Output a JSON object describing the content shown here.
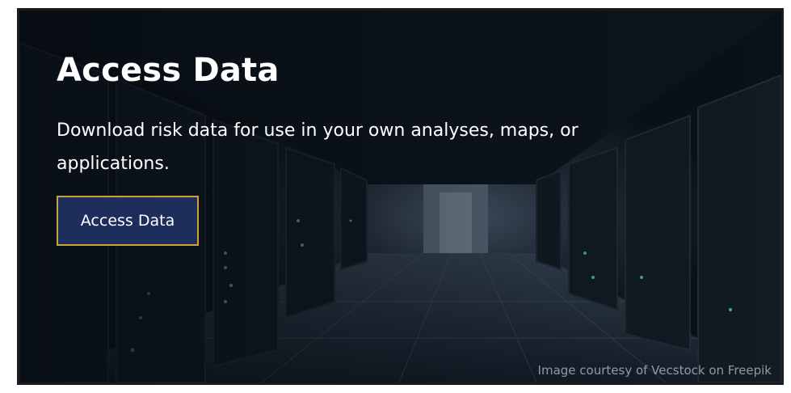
{
  "hero": {
    "title": "Access Data",
    "description": "Download risk data for use in your own analyses, maps, or applications.",
    "button_label": "Access Data",
    "image_credit": "Image courtesy of Vecstock on Freepik",
    "background_image": "server-room-corridor"
  },
  "colors": {
    "button_bg": "#1d2d5c",
    "button_border": "#c9a23c",
    "text": "#ffffff"
  }
}
